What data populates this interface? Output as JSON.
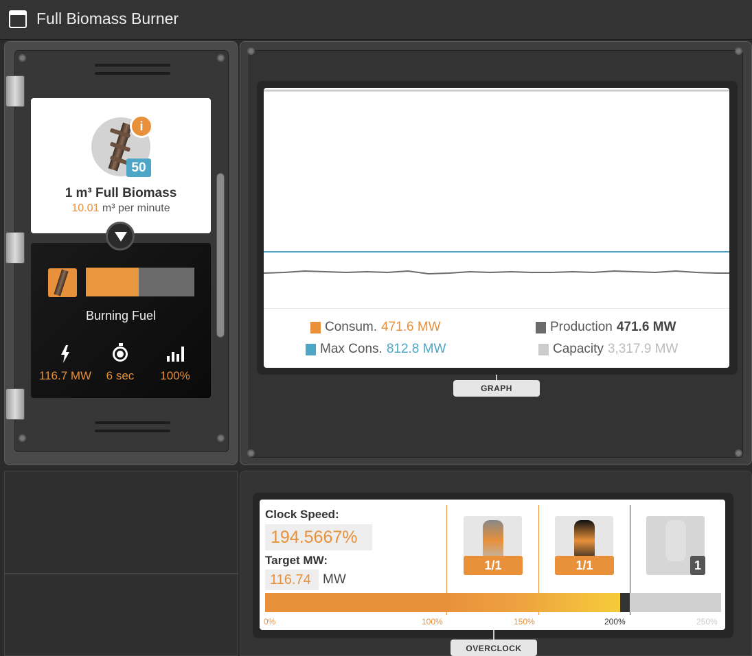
{
  "window": {
    "title": "Full Biomass Burner"
  },
  "fuel": {
    "name": "1 m³ Full Biomass",
    "rate_value": "10.01",
    "rate_unit": "m³ per minute",
    "count": "50",
    "icon": "biomass-pipe-icon",
    "info_icon": "info-icon"
  },
  "burner": {
    "status_label": "Burning Fuel",
    "progress": 0.49,
    "stats": [
      {
        "icon": "lightning-icon",
        "value": "116.7 MW"
      },
      {
        "icon": "timer-icon",
        "value": "6 sec"
      },
      {
        "icon": "bar-chart-icon",
        "value": "100%"
      }
    ]
  },
  "graph": {
    "tab_label": "GRAPH",
    "legend": {
      "consum_label": "Consum.",
      "consum_value": "471.6 MW",
      "production_label": "Production",
      "production_value": "471.6 MW",
      "maxcons_label": "Max Cons.",
      "maxcons_value": "812.8 MW",
      "capacity_label": "Capacity",
      "capacity_value": "3,317.9 MW"
    },
    "colors": {
      "consumption": "#e8903a",
      "production": "#6b6b6b",
      "max_consumption": "#4ea6c6",
      "capacity": "#cccccc"
    }
  },
  "overclock": {
    "tab_label": "OVERCLOCK",
    "clock_label": "Clock Speed:",
    "clock_value": "194.5667%",
    "target_label": "Target MW:",
    "target_value": "116.74",
    "target_unit": "MW",
    "shards": [
      {
        "badge": "1/1",
        "state": "used"
      },
      {
        "badge": "1/1",
        "state": "used"
      },
      {
        "badge": "1",
        "state": "empty"
      }
    ],
    "clock_speed_percent": 194.5667,
    "scale_max_percent": 250,
    "ticks": [
      "0%",
      "100%",
      "150%",
      "200%",
      "250%"
    ]
  }
}
